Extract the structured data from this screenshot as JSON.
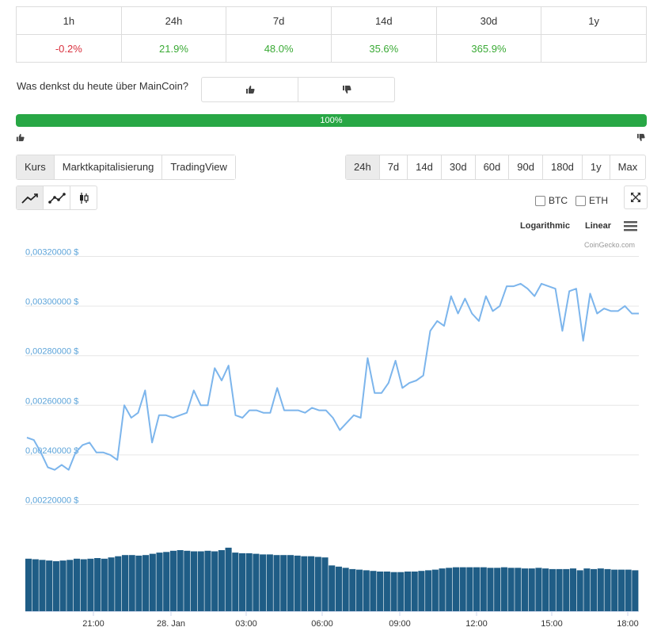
{
  "performance": {
    "headers": [
      "1h",
      "24h",
      "7d",
      "14d",
      "30d",
      "1y"
    ],
    "values": [
      "-0.2%",
      "21.9%",
      "48.0%",
      "35.6%",
      "365.9%",
      ""
    ]
  },
  "sentiment": {
    "question": "Was denkst du heute über MainCoin?",
    "percent": 100,
    "percent_label": "100%"
  },
  "tabs": [
    "Kurs",
    "Marktkapitalisierung",
    "TradingView"
  ],
  "ranges": [
    "24h",
    "7d",
    "14d",
    "30d",
    "60d",
    "90d",
    "180d",
    "1y",
    "Max"
  ],
  "compare": {
    "btc": "BTC",
    "eth": "ETH"
  },
  "scale": {
    "log": "Logarithmic",
    "linear": "Linear"
  },
  "credit": "CoinGecko.com",
  "colors": {
    "line": "#7cb5ec",
    "volume": "#1f5d86",
    "up": "#3aaa35",
    "down": "#d9303d",
    "bar": "#28a745"
  },
  "chart_data": {
    "type": "line",
    "ylim": [
      0.0022,
      0.0032
    ],
    "y_ticks": [
      "0,00220000 $",
      "0,00240000 $",
      "0,00260000 $",
      "0,00280000 $",
      "0,00300000 $",
      "0,00320000 $"
    ],
    "x_ticks": [
      "21:00",
      "28. Jan",
      "03:00",
      "06:00",
      "09:00",
      "12:00",
      "15:00",
      "18:00"
    ],
    "grid": true,
    "price": [
      0.00247,
      0.00246,
      0.00241,
      0.00235,
      0.00234,
      0.00236,
      0.00234,
      0.00241,
      0.00244,
      0.00245,
      0.00241,
      0.00241,
      0.0024,
      0.00238,
      0.0026,
      0.00255,
      0.00257,
      0.00266,
      0.00245,
      0.00256,
      0.00256,
      0.00255,
      0.00256,
      0.00257,
      0.00266,
      0.0026,
      0.0026,
      0.00275,
      0.0027,
      0.00276,
      0.00256,
      0.00255,
      0.00258,
      0.00258,
      0.00257,
      0.00257,
      0.00267,
      0.00258,
      0.00258,
      0.00258,
      0.00257,
      0.00259,
      0.00258,
      0.00258,
      0.00255,
      0.0025,
      0.00253,
      0.00256,
      0.00255,
      0.00279,
      0.00265,
      0.00265,
      0.00269,
      0.00278,
      0.00267,
      0.00269,
      0.0027,
      0.00272,
      0.0029,
      0.00294,
      0.00292,
      0.00304,
      0.00297,
      0.00303,
      0.00297,
      0.00294,
      0.00304,
      0.00298,
      0.003,
      0.00308,
      0.00308,
      0.00309,
      0.00307,
      0.00304,
      0.00309,
      0.00308,
      0.00307,
      0.0029,
      0.00306,
      0.00307,
      0.00286,
      0.00305,
      0.00297,
      0.00299,
      0.00298,
      0.00298,
      0.003,
      0.00297,
      0.00297
    ],
    "volume": [
      0.86,
      0.85,
      0.84,
      0.83,
      0.82,
      0.83,
      0.84,
      0.86,
      0.85,
      0.86,
      0.87,
      0.86,
      0.88,
      0.9,
      0.92,
      0.92,
      0.91,
      0.92,
      0.94,
      0.96,
      0.97,
      0.99,
      1.0,
      0.99,
      0.98,
      0.98,
      0.99,
      0.98,
      1.0,
      1.04,
      0.96,
      0.95,
      0.95,
      0.94,
      0.93,
      0.93,
      0.92,
      0.92,
      0.92,
      0.91,
      0.9,
      0.9,
      0.89,
      0.88,
      0.75,
      0.73,
      0.71,
      0.69,
      0.68,
      0.67,
      0.66,
      0.65,
      0.65,
      0.64,
      0.64,
      0.65,
      0.65,
      0.66,
      0.67,
      0.68,
      0.7,
      0.71,
      0.72,
      0.72,
      0.72,
      0.72,
      0.72,
      0.71,
      0.71,
      0.72,
      0.71,
      0.71,
      0.7,
      0.7,
      0.71,
      0.7,
      0.69,
      0.69,
      0.69,
      0.7,
      0.67,
      0.7,
      0.69,
      0.7,
      0.69,
      0.68,
      0.68,
      0.68,
      0.67
    ]
  }
}
